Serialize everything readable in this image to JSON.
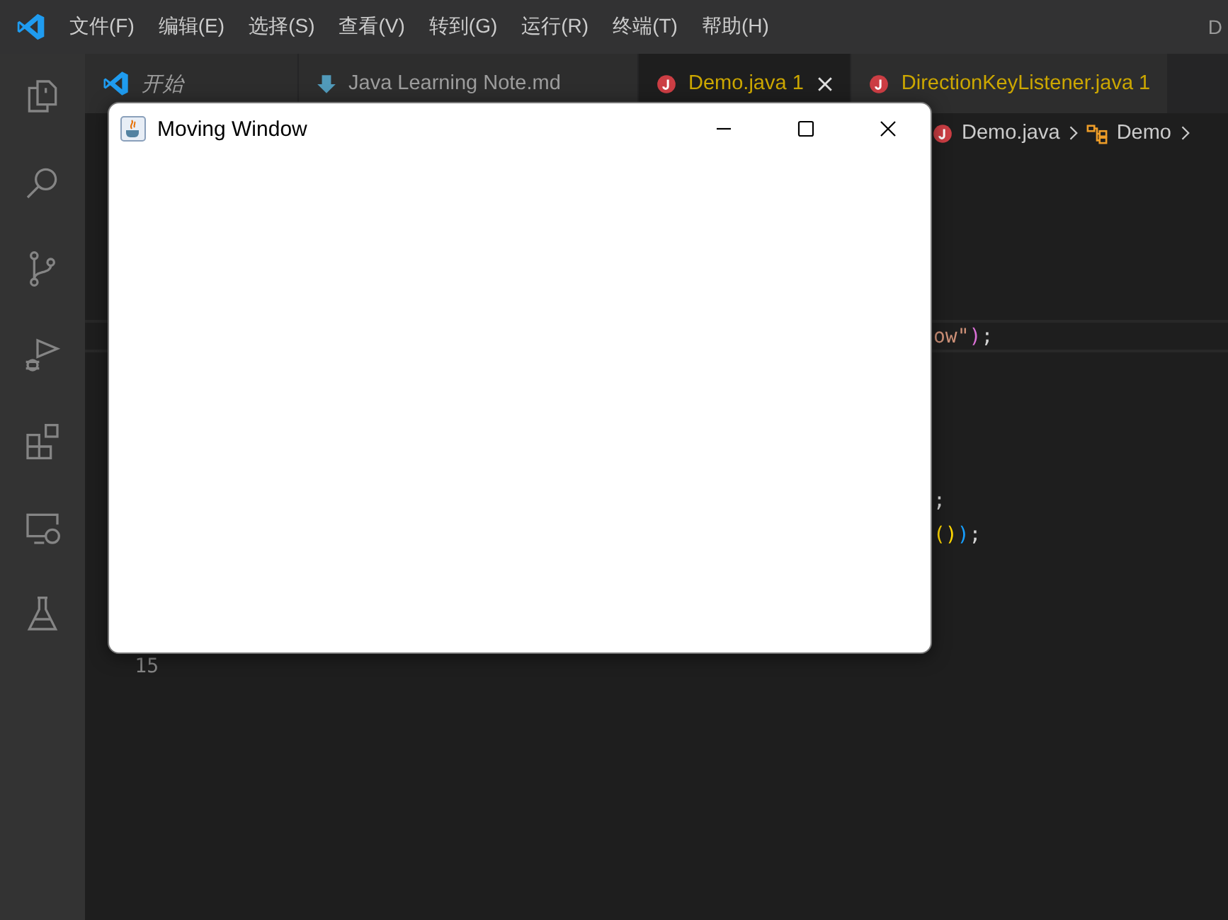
{
  "menu": [
    "文件(F)",
    "编辑(E)",
    "选择(S)",
    "查看(V)",
    "转到(G)",
    "运行(R)",
    "终端(T)",
    "帮助(H)"
  ],
  "title_fragment": "D",
  "tabs": [
    {
      "kind": "welcome",
      "label": "开始",
      "selected": false,
      "warning": false
    },
    {
      "kind": "markdown",
      "label": "Java Learning Note.md",
      "selected": false,
      "warning": false
    },
    {
      "kind": "java",
      "label": "Demo.java",
      "count": "1",
      "selected": true,
      "warning": true
    },
    {
      "kind": "java",
      "label": "DirectionKeyListener.java",
      "count": "1",
      "selected": false,
      "warning": true
    }
  ],
  "breadcrumb": [
    {
      "kind": "java",
      "label": "Demo.java"
    },
    {
      "kind": "class",
      "label": "Demo"
    }
  ],
  "editor_lines": [
    {
      "current": true,
      "tokens": [
        {
          "text": "ow\"",
          "color": "#ce9178"
        },
        {
          "text": ")",
          "color": "#da70d6"
        },
        {
          "text": ";"
        }
      ]
    },
    {
      "tokens": [
        {
          "text": ";"
        }
      ]
    },
    {
      "tokens": [
        {
          "text": "()",
          "color": "#ffd700"
        },
        {
          "text": ")",
          "color": "#179fff"
        },
        {
          "text": ";"
        }
      ]
    },
    {
      "number": "15"
    }
  ],
  "java_window": {
    "title": "Moving Window"
  }
}
